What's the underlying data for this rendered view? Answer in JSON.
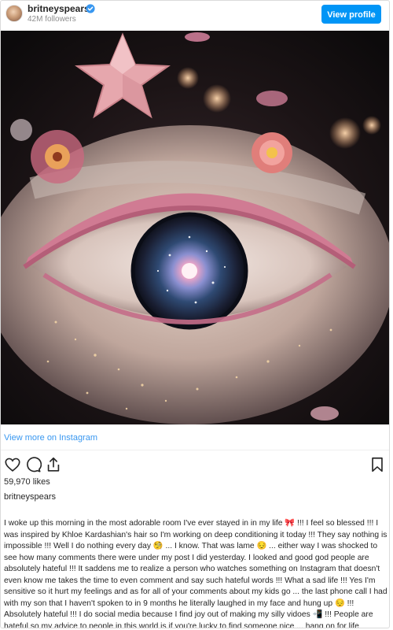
{
  "header": {
    "username": "britneyspears",
    "followers": "42M followers",
    "view_profile_label": "View profile",
    "verified_icon": "verified-badge-icon"
  },
  "post": {
    "image_alt": "Surreal eye with galaxy iris, pink eyelashes, flowers and star",
    "view_more_label": "View more on Instagram",
    "likes": "59,970 likes",
    "caption_user": "britneyspears",
    "caption": "I woke up this morning in the most adorable room I've ever stayed in in my life 🎀 !!! I feel so blessed !!! I was inspired by Khloe Kardashian's hair so I'm working on deep conditioning it today !!! They say nothing is impossible !!! Well I do nothing every day 🧐 ... I know. That was lame 😔 ... either way I was shocked to see how many comments there were under my post I did yesterday. I looked and good god people are absolutely hateful !!! It saddens me to realize a person who watches something on Instagram that doesn't even know me takes the time to even comment and say such hateful words !!! What a sad life !!! Yes I'm sensitive so it hurt my feelings and as for all of your comments about my kids go ... the last phone call I had with my son that I haven't spoken to in 9 months he literally laughed in my face and hung up 😔 !!! Absolutely hateful !!! I do social media because I find joy out of making my silly vidoes 📲 !!! People are hateful so my advice to people in this world is if you're lucky to find someone nice ... hang on for life because those are rare 💎 !!!"
  },
  "actions": {
    "like_icon": "heart-icon",
    "comment_icon": "comment-icon",
    "share_icon": "share-icon",
    "save_icon": "bookmark-icon"
  },
  "colors": {
    "accent": "#0095f6",
    "link": "#3897f0",
    "verified": "#3897f0"
  }
}
